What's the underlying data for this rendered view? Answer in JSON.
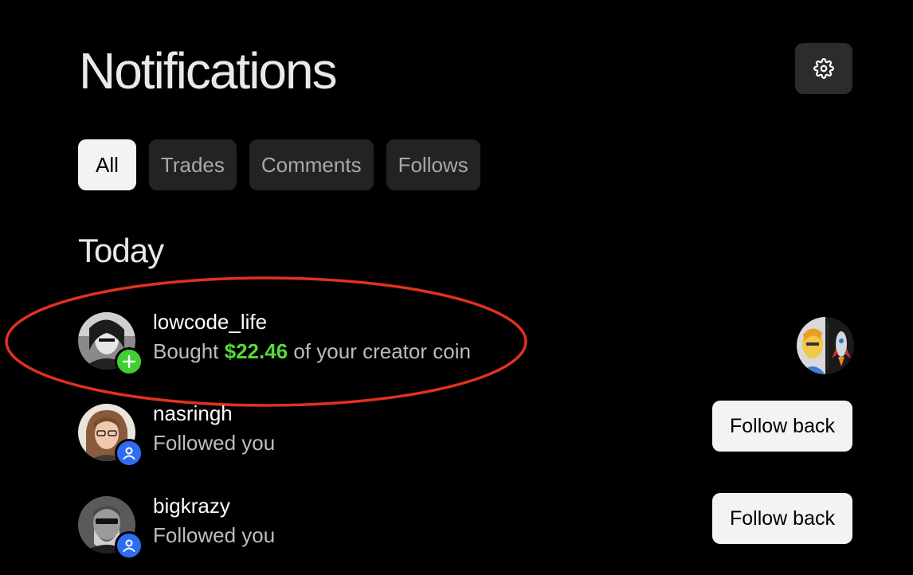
{
  "header": {
    "title": "Notifications",
    "settings_icon": "gear-icon"
  },
  "tabs": [
    {
      "label": "All",
      "active": true
    },
    {
      "label": "Trades",
      "active": false
    },
    {
      "label": "Comments",
      "active": false
    },
    {
      "label": "Follows",
      "active": false
    }
  ],
  "section": {
    "title": "Today"
  },
  "notifications": [
    {
      "username": "lowcode_life",
      "action_prefix": "Bought ",
      "amount": "$22.46",
      "action_suffix": " of your creator coin",
      "badge": "plus-icon",
      "badge_color": "#3fcf35",
      "highlighted": true
    },
    {
      "username": "nasringh",
      "action": "Followed you",
      "badge": "person-icon",
      "badge_color": "#2f6df0",
      "button": "Follow back"
    },
    {
      "username": "bigkrazy",
      "action": "Followed you",
      "badge": "person-icon",
      "badge_color": "#2f6df0",
      "button": "Follow back"
    }
  ],
  "colors": {
    "accent_green": "#56d93a",
    "highlight_ring": "#e0321f",
    "background": "#000000"
  }
}
